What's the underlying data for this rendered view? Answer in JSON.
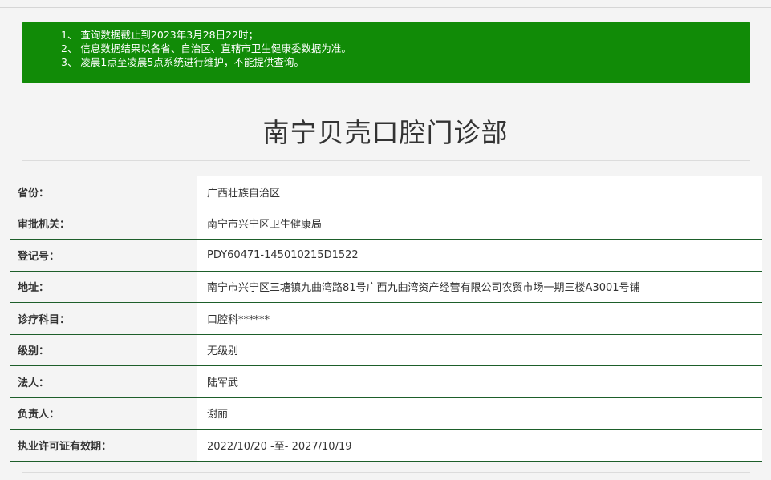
{
  "notice": {
    "lines": [
      "1、 查询数据截止到2023年3月28日22时；",
      "2、 信息数据结果以各省、自治区、直辖市卫生健康委数据为准。",
      "3、 凌晨1点至凌晨5点系统进行维护，不能提供查询。"
    ]
  },
  "title": "南宁贝壳口腔门诊部",
  "rows": [
    {
      "label": "省份：",
      "value": "广西壮族自治区"
    },
    {
      "label": "审批机关：",
      "value": "南宁市兴宁区卫生健康局"
    },
    {
      "label": "登记号：",
      "value": "PDY60471-145010215D1522"
    },
    {
      "label": "地址：",
      "value": "南宁市兴宁区三塘镇九曲湾路81号广西九曲湾资产经营有限公司农贸市场一期三楼A3001号铺"
    },
    {
      "label": "诊疗科目：",
      "value": "口腔科******"
    },
    {
      "label": "级别：",
      "value": "无级别"
    },
    {
      "label": "法人：",
      "value": "陆军武"
    },
    {
      "label": "负责人：",
      "value": "谢丽"
    },
    {
      "label": "执业许可证有效期：",
      "value": "2022/10/20 -至- 2027/10/19"
    }
  ],
  "colors": {
    "notice_bg": "#118b07",
    "row_divider": "#1d5e2a",
    "page_bg": "#f4f4f4"
  }
}
